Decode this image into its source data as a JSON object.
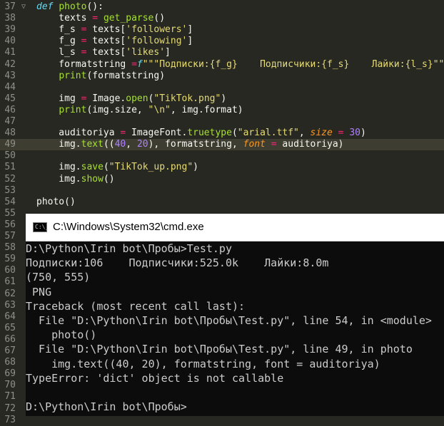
{
  "editor": {
    "lines": [
      {
        "n": "37",
        "fold": "▽",
        "parts": [
          {
            "t": "def ",
            "c": "kw"
          },
          {
            "t": "photo",
            "c": "fn"
          },
          {
            "t": "():",
            "c": "plain"
          }
        ]
      },
      {
        "n": "38",
        "parts": [
          {
            "t": "    texts ",
            "c": "plain"
          },
          {
            "t": "=",
            "c": "op"
          },
          {
            "t": " ",
            "c": "plain"
          },
          {
            "t": "get_parse",
            "c": "fn"
          },
          {
            "t": "()",
            "c": "plain"
          }
        ]
      },
      {
        "n": "39",
        "parts": [
          {
            "t": "    f_s ",
            "c": "plain"
          },
          {
            "t": "=",
            "c": "op"
          },
          {
            "t": " texts[",
            "c": "plain"
          },
          {
            "t": "'followers'",
            "c": "str"
          },
          {
            "t": "]",
            "c": "plain"
          }
        ]
      },
      {
        "n": "40",
        "parts": [
          {
            "t": "    f_g ",
            "c": "plain"
          },
          {
            "t": "=",
            "c": "op"
          },
          {
            "t": " texts[",
            "c": "plain"
          },
          {
            "t": "'following'",
            "c": "str"
          },
          {
            "t": "]",
            "c": "plain"
          }
        ]
      },
      {
        "n": "41",
        "parts": [
          {
            "t": "    l_s ",
            "c": "plain"
          },
          {
            "t": "=",
            "c": "op"
          },
          {
            "t": " texts[",
            "c": "plain"
          },
          {
            "t": "'likes'",
            "c": "str"
          },
          {
            "t": "]",
            "c": "plain"
          }
        ]
      },
      {
        "n": "42",
        "parts": [
          {
            "t": "    formatstring ",
            "c": "plain"
          },
          {
            "t": "=",
            "c": "op"
          },
          {
            "t": "f",
            "c": "kw"
          },
          {
            "t": "\"\"\"Подписки:{f_g}    Подписчики:{f_s}    Лайки:{l_s}\"\"\"",
            "c": "str"
          }
        ]
      },
      {
        "n": "43",
        "parts": [
          {
            "t": "    ",
            "c": "plain"
          },
          {
            "t": "print",
            "c": "fn"
          },
          {
            "t": "(formatstring)",
            "c": "plain"
          }
        ]
      },
      {
        "n": "44",
        "parts": []
      },
      {
        "n": "45",
        "parts": [
          {
            "t": "    img ",
            "c": "plain"
          },
          {
            "t": "=",
            "c": "op"
          },
          {
            "t": " Image.",
            "c": "plain"
          },
          {
            "t": "open",
            "c": "fn"
          },
          {
            "t": "(",
            "c": "plain"
          },
          {
            "t": "\"TikTok.png\"",
            "c": "str"
          },
          {
            "t": ")",
            "c": "plain"
          }
        ]
      },
      {
        "n": "46",
        "parts": [
          {
            "t": "    ",
            "c": "plain"
          },
          {
            "t": "print",
            "c": "fn"
          },
          {
            "t": "(img.size, ",
            "c": "plain"
          },
          {
            "t": "\"\\n\"",
            "c": "str"
          },
          {
            "t": ", img.format)",
            "c": "plain"
          }
        ]
      },
      {
        "n": "47",
        "parts": []
      },
      {
        "n": "48",
        "parts": [
          {
            "t": "    auditoriya ",
            "c": "plain"
          },
          {
            "t": "=",
            "c": "op"
          },
          {
            "t": " ImageFont.",
            "c": "plain"
          },
          {
            "t": "truetype",
            "c": "fn"
          },
          {
            "t": "(",
            "c": "plain"
          },
          {
            "t": "\"arial.ttf\"",
            "c": "str"
          },
          {
            "t": ", ",
            "c": "plain"
          },
          {
            "t": "size",
            "c": "param"
          },
          {
            "t": " ",
            "c": "plain"
          },
          {
            "t": "=",
            "c": "op"
          },
          {
            "t": " ",
            "c": "plain"
          },
          {
            "t": "30",
            "c": "num"
          },
          {
            "t": ")",
            "c": "plain"
          }
        ]
      },
      {
        "n": "49",
        "active": true,
        "parts": [
          {
            "t": "    img.",
            "c": "plain"
          },
          {
            "t": "text",
            "c": "fn"
          },
          {
            "t": "((",
            "c": "plain"
          },
          {
            "t": "40",
            "c": "num"
          },
          {
            "t": ", ",
            "c": "plain"
          },
          {
            "t": "20",
            "c": "num"
          },
          {
            "t": "), formatstring, ",
            "c": "plain"
          },
          {
            "t": "font",
            "c": "param"
          },
          {
            "t": " ",
            "c": "plain"
          },
          {
            "t": "=",
            "c": "op"
          },
          {
            "t": " auditoriya)",
            "c": "plain"
          }
        ]
      },
      {
        "n": "50",
        "parts": []
      },
      {
        "n": "51",
        "parts": [
          {
            "t": "    img.",
            "c": "plain"
          },
          {
            "t": "save",
            "c": "fn"
          },
          {
            "t": "(",
            "c": "plain"
          },
          {
            "t": "\"TikTok_up.png\"",
            "c": "str"
          },
          {
            "t": ")",
            "c": "plain"
          }
        ]
      },
      {
        "n": "52",
        "parts": [
          {
            "t": "    img.",
            "c": "plain"
          },
          {
            "t": "show",
            "c": "fn"
          },
          {
            "t": "()",
            "c": "plain"
          }
        ]
      },
      {
        "n": "53",
        "parts": []
      },
      {
        "n": "54",
        "parts": [
          {
            "t": "photo",
            "c": "plain"
          },
          {
            "t": "()",
            "c": "plain"
          }
        ]
      },
      {
        "n": "55",
        "parts": []
      },
      {
        "n": "56",
        "parts": []
      },
      {
        "n": "57",
        "parts": []
      },
      {
        "n": "58",
        "parts": []
      },
      {
        "n": "59",
        "parts": []
      },
      {
        "n": "60",
        "parts": []
      },
      {
        "n": "61",
        "parts": []
      },
      {
        "n": "62",
        "parts": []
      },
      {
        "n": "63",
        "parts": []
      },
      {
        "n": "64",
        "parts": []
      },
      {
        "n": "65",
        "parts": []
      },
      {
        "n": "66",
        "parts": []
      },
      {
        "n": "67",
        "parts": []
      },
      {
        "n": "68",
        "parts": []
      },
      {
        "n": "69",
        "parts": []
      },
      {
        "n": "70",
        "parts": []
      },
      {
        "n": "71",
        "parts": []
      },
      {
        "n": "72",
        "parts": []
      },
      {
        "n": "73",
        "parts": []
      }
    ]
  },
  "cmd": {
    "title": "C:\\Windows\\System32\\cmd.exe",
    "icon_text": "C:\\_",
    "lines": [
      "D:\\Python\\Irin bot\\Пробы>Test.py",
      "Подписки:106    Подписчики:525.0k    Лайки:8.0m",
      "(750, 555)",
      " PNG",
      "Traceback (most recent call last):",
      "  File \"D:\\Python\\Irin bot\\Пробы\\Test.py\", line 54, in <module>",
      "    photo()",
      "  File \"D:\\Python\\Irin bot\\Пробы\\Test.py\", line 49, in photo",
      "    img.text((40, 20), formatstring, font = auditoriya)",
      "TypeError: 'dict' object is not callable",
      "",
      "D:\\Python\\Irin bot\\Пробы>"
    ]
  }
}
